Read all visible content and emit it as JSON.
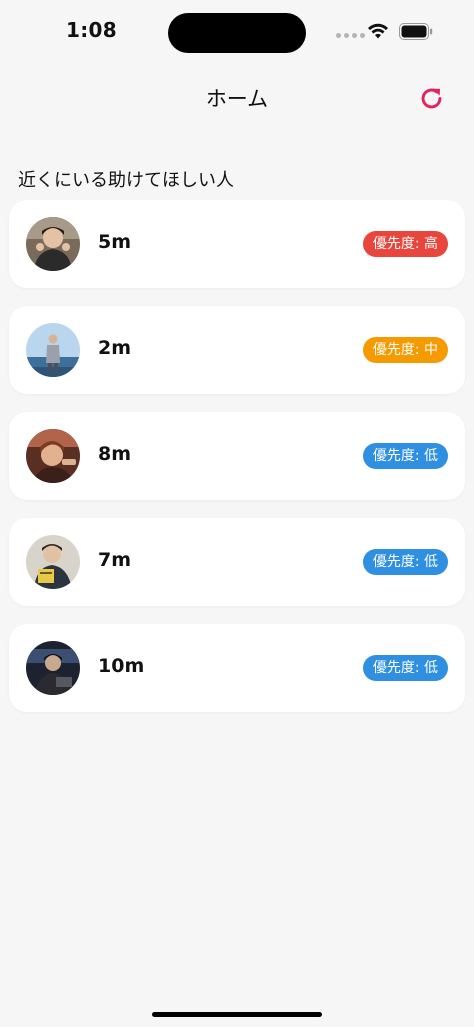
{
  "status_bar": {
    "time": "1:08"
  },
  "nav": {
    "title": "ホーム",
    "refresh_icon": "refresh-icon"
  },
  "section": {
    "title": "近くにいる助けてほしい人"
  },
  "colors": {
    "accent": "#e0245e",
    "priority_high": "#e8453c",
    "priority_mid": "#f59b00",
    "priority_low": "#2f8fe0"
  },
  "people": [
    {
      "distance": "5m",
      "priority": "優先度: 高",
      "level": "high",
      "avatar": "avatar-person-1"
    },
    {
      "distance": "2m",
      "priority": "優先度: 中",
      "level": "mid",
      "avatar": "avatar-person-2"
    },
    {
      "distance": "8m",
      "priority": "優先度: 低",
      "level": "low",
      "avatar": "avatar-person-3"
    },
    {
      "distance": "7m",
      "priority": "優先度: 低",
      "level": "low",
      "avatar": "avatar-person-4"
    },
    {
      "distance": "10m",
      "priority": "優先度: 低",
      "level": "low",
      "avatar": "avatar-person-5"
    }
  ]
}
